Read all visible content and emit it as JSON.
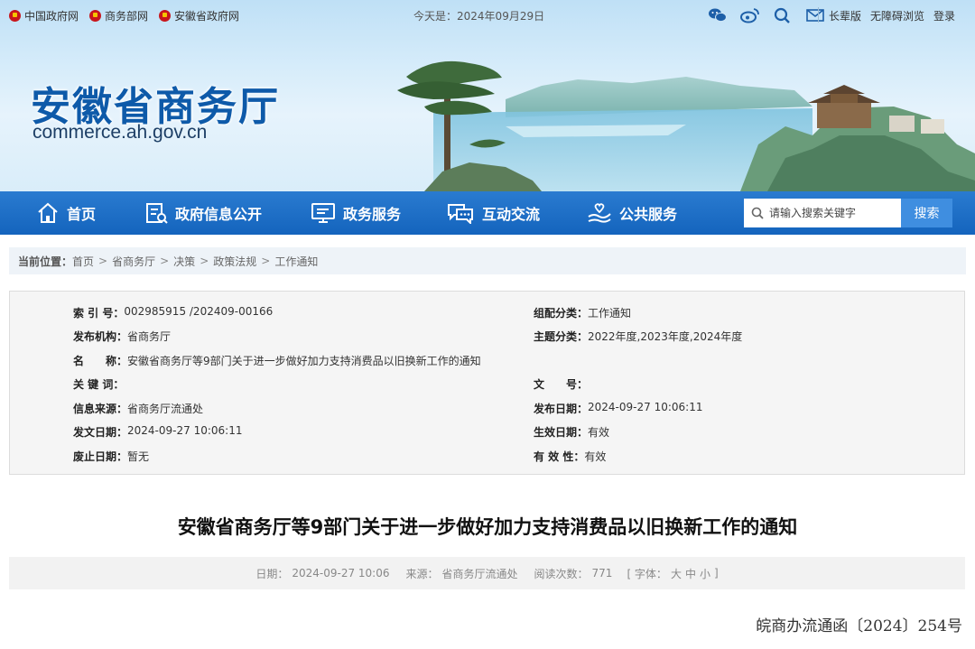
{
  "topbar": {
    "links": [
      "中国政府网",
      "商务部网",
      "安徽省政府网"
    ],
    "today_label": "今天是：",
    "today_value": "2024年09月29日",
    "icons": [
      "wechat-icon",
      "weibo-icon",
      "search-icon",
      "mail-icon"
    ],
    "elder_label": "长辈版",
    "accessible_label": "无障碍浏览",
    "login_label": "登录"
  },
  "site": {
    "name": "安徽省商务厅",
    "domain": "commerce.ah.gov.cn"
  },
  "nav": {
    "items": [
      {
        "label": "首页",
        "icon": "home-icon"
      },
      {
        "label": "政府信息公开",
        "icon": "info-disclosure-icon"
      },
      {
        "label": "政务服务",
        "icon": "monitor-icon"
      },
      {
        "label": "互动交流",
        "icon": "chat-icon"
      },
      {
        "label": "公共服务",
        "icon": "hand-heart-icon"
      }
    ],
    "search_placeholder": "请输入搜索关键字",
    "search_button": "搜索"
  },
  "breadcrumb": {
    "label": "当前位置：",
    "items": [
      "首页",
      "省商务厅",
      "决策",
      "政策法规",
      "工作通知"
    ],
    "separator": ">"
  },
  "info": {
    "left": [
      {
        "key": "索 引 号：",
        "value": "002985915 /202409-00166"
      },
      {
        "key": "发布机构：",
        "value": "省商务厅"
      },
      {
        "key": "名　　称：",
        "value": "安徽省商务厅等9部门关于进一步做好加力支持消费品以旧换新工作的通知"
      },
      {
        "key": "关 键 词：",
        "value": ""
      },
      {
        "key": "信息来源：",
        "value": "省商务厅流通处"
      },
      {
        "key": "发文日期：",
        "value": "2024-09-27 10:06:11"
      },
      {
        "key": "废止日期：",
        "value": "暂无"
      }
    ],
    "right": [
      {
        "key": "组配分类：",
        "value": "工作通知"
      },
      {
        "key": "主题分类：",
        "value": "2022年度,2023年度,2024年度"
      },
      {
        "key": "文　　号：",
        "value": ""
      },
      {
        "key": "发布日期：",
        "value": "2024-09-27 10:06:11"
      },
      {
        "key": "生效日期：",
        "value": "有效"
      },
      {
        "key": "有 效 性：",
        "value": "有效"
      }
    ]
  },
  "article": {
    "title": "安徽省商务厅等9部门关于进一步做好加力支持消费品以旧换新工作的通知",
    "date_label": "日期：",
    "date_value": "2024-09-27 10:06",
    "source_label": "来源：",
    "source_value": "省商务厅流通处",
    "views_label": "阅读次数：",
    "views_value": "771",
    "font_label": "[ 字体：",
    "font_large": "大",
    "font_medium": "中",
    "font_small": "小",
    "font_close": "]",
    "doc_number": "皖商办流通函〔2024〕254号"
  },
  "colors": {
    "nav_blue": "#1464bd",
    "logo_blue": "#0e5aa9",
    "search_button": "#3f8ee0"
  }
}
